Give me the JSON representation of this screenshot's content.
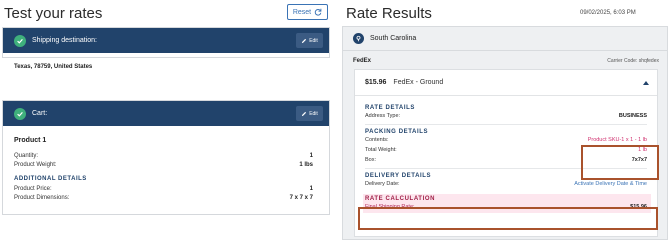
{
  "left": {
    "title": "Test your rates",
    "reset_label": "Reset",
    "destination": {
      "title": "Shipping destination:",
      "edit_label": "Edit",
      "value": "Texas, 78759, United States"
    },
    "cart": {
      "title": "Cart:",
      "edit_label": "Edit",
      "product_name": "Product 1",
      "quantity_label": "Quantity:",
      "quantity_value": "1",
      "weight_label": "Product Weight:",
      "weight_value": "1 lbs",
      "additional_title": "ADDITIONAL DETAILS",
      "price_label": "Product Price:",
      "price_value": "1",
      "dims_label": "Product Dimensions:",
      "dims_value": "7 x 7 x 7"
    }
  },
  "right": {
    "title": "Rate Results",
    "timestamp": "09/02/2025, 6:03 PM",
    "state": "South Carolina",
    "carrier": "FedEx",
    "carrier_code": "Carrier Code: shqfedex",
    "rate": {
      "price": "$15.96",
      "service": "FedEx - Ground",
      "rate_details_title": "RATE DETAILS",
      "address_type_label": "Address Type:",
      "address_type_value": "BUSINESS",
      "packing_title": "PACKING DETAILS",
      "contents_label": "Contents:",
      "contents_value": "Product SKU-1 x 1 - 1 lb",
      "total_weight_label": "Total Weight:",
      "total_weight_value": "1 lb",
      "box_label": "Box:",
      "box_value": "7x7x7",
      "delivery_title": "DELIVERY DETAILS",
      "delivery_date_label": "Delivery Date:",
      "delivery_date_value": "Activate Delivery Date & Time",
      "calc_title": "RATE CALCULATION",
      "final_rate_label": "Final Shipping Rate:",
      "final_rate_value": "$15.96"
    }
  },
  "colors": {
    "header_navy": "#21436b",
    "check_green": "#3fb07c",
    "highlight_border": "#a9522c",
    "highlight_fill": "#fde6ee",
    "link_blue": "#3a73b5"
  },
  "icons": [
    "check-circle-icon",
    "pencil-icon",
    "refresh-icon",
    "map-pin-icon",
    "caret-up-icon"
  ]
}
